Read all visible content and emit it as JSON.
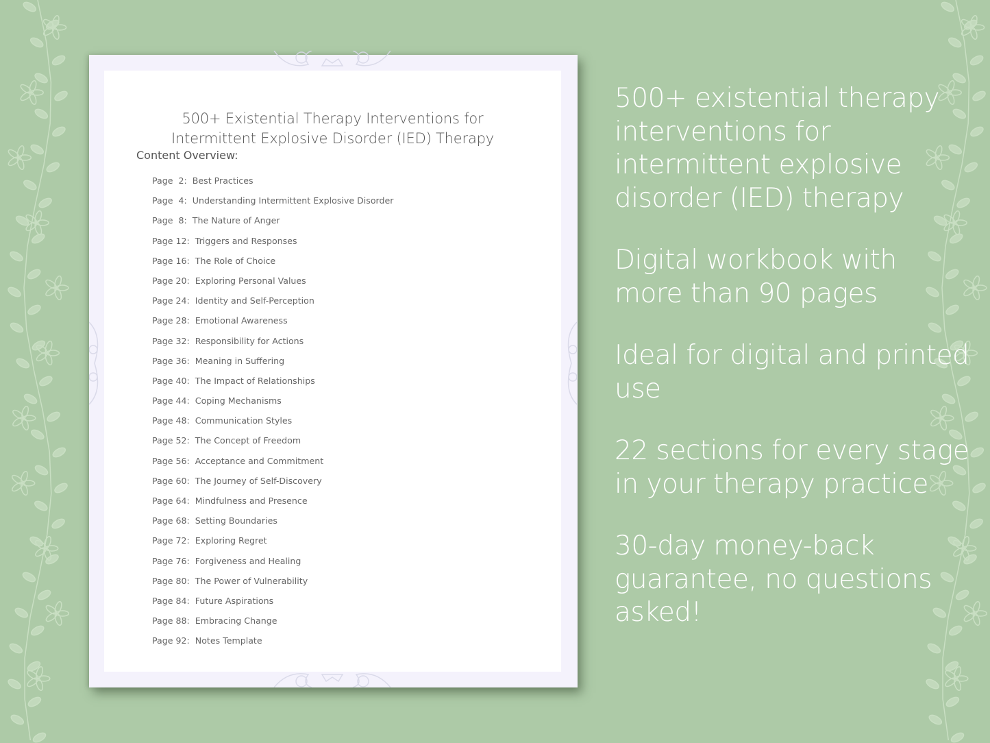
{
  "document": {
    "title_line1": "500+ Existential Therapy Interventions for",
    "title_line2": "Intermittent Explosive Disorder (IED) Therapy",
    "overview_label": "Content Overview:",
    "toc": [
      {
        "page": "Page  2:",
        "title": "Best Practices"
      },
      {
        "page": "Page  4:",
        "title": "Understanding Intermittent Explosive Disorder"
      },
      {
        "page": "Page  8:",
        "title": "The Nature of Anger"
      },
      {
        "page": "Page 12:",
        "title": "Triggers and Responses"
      },
      {
        "page": "Page 16:",
        "title": "The Role of Choice"
      },
      {
        "page": "Page 20:",
        "title": "Exploring Personal Values"
      },
      {
        "page": "Page 24:",
        "title": "Identity and Self-Perception"
      },
      {
        "page": "Page 28:",
        "title": "Emotional Awareness"
      },
      {
        "page": "Page 32:",
        "title": "Responsibility for Actions"
      },
      {
        "page": "Page 36:",
        "title": "Meaning in Suffering"
      },
      {
        "page": "Page 40:",
        "title": "The Impact of Relationships"
      },
      {
        "page": "Page 44:",
        "title": "Coping Mechanisms"
      },
      {
        "page": "Page 48:",
        "title": "Communication Styles"
      },
      {
        "page": "Page 52:",
        "title": "The Concept of Freedom"
      },
      {
        "page": "Page 56:",
        "title": "Acceptance and Commitment"
      },
      {
        "page": "Page 60:",
        "title": "The Journey of Self-Discovery"
      },
      {
        "page": "Page 64:",
        "title": "Mindfulness and Presence"
      },
      {
        "page": "Page 68:",
        "title": "Setting Boundaries"
      },
      {
        "page": "Page 72:",
        "title": "Exploring Regret"
      },
      {
        "page": "Page 76:",
        "title": "Forgiveness and Healing"
      },
      {
        "page": "Page 80:",
        "title": "The Power of Vulnerability"
      },
      {
        "page": "Page 84:",
        "title": "Future Aspirations"
      },
      {
        "page": "Page 88:",
        "title": "Embracing Change"
      },
      {
        "page": "Page 92:",
        "title": "Notes Template"
      }
    ]
  },
  "features": [
    "500+ existential therapy interventions for intermittent explosive disorder (IED) therapy",
    "Digital workbook with more than 90 pages",
    "Ideal for digital and printed use",
    "22 sections for every stage in your therapy practice",
    "30-day money-back guarantee, no questions asked!"
  ],
  "colors": {
    "background": "#adcaa7",
    "sheet_border": "#f4f2fc",
    "text_dark": "#555555",
    "feature_text": "#ffffff"
  },
  "decorations": {
    "left_border": "floral-vine",
    "right_border": "floral-vine",
    "sheet_ornament": "mandala"
  }
}
